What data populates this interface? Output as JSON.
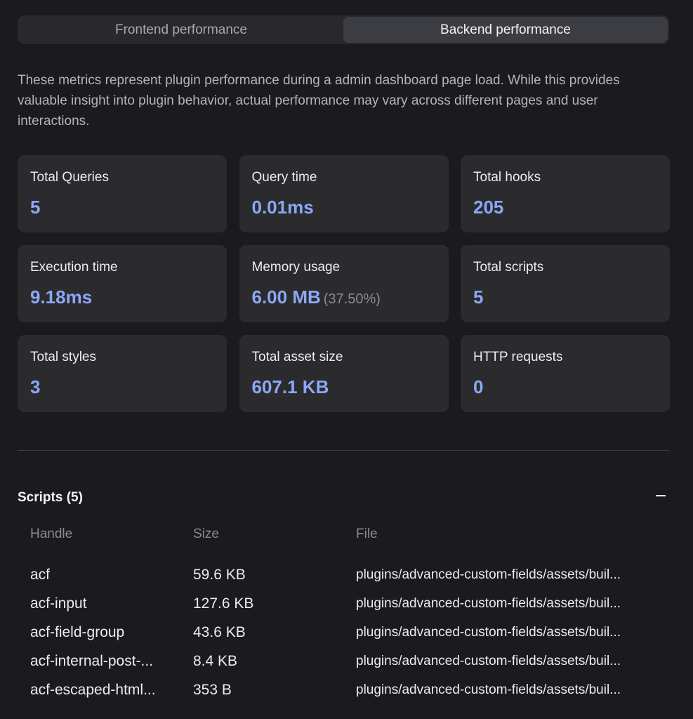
{
  "tabs": [
    {
      "label": "Frontend performance",
      "active": false
    },
    {
      "label": "Backend performance",
      "active": true
    }
  ],
  "description": "These metrics represent plugin performance during a admin dashboard page load. While this provides valuable insight into plugin behavior, actual performance may vary across different pages and user interactions.",
  "metrics": [
    {
      "label": "Total Queries",
      "value": "5",
      "sub": ""
    },
    {
      "label": "Query time",
      "value": "0.01ms",
      "sub": ""
    },
    {
      "label": "Total hooks",
      "value": "205",
      "sub": ""
    },
    {
      "label": "Execution time",
      "value": "9.18ms",
      "sub": ""
    },
    {
      "label": "Memory usage",
      "value": "6.00 MB",
      "sub": "(37.50%)"
    },
    {
      "label": "Total scripts",
      "value": "5",
      "sub": ""
    },
    {
      "label": "Total styles",
      "value": "3",
      "sub": ""
    },
    {
      "label": "Total asset size",
      "value": "607.1 KB",
      "sub": ""
    },
    {
      "label": "HTTP requests",
      "value": "0",
      "sub": ""
    }
  ],
  "scripts": {
    "title": "Scripts (5)",
    "collapse_icon": "minus-icon",
    "columns": {
      "handle": "Handle",
      "size": "Size",
      "file": "File"
    },
    "rows": [
      {
        "handle": "acf",
        "size": "59.6 KB",
        "file": "plugins/advanced-custom-fields/assets/buil..."
      },
      {
        "handle": "acf-input",
        "size": "127.6 KB",
        "file": "plugins/advanced-custom-fields/assets/buil..."
      },
      {
        "handle": "acf-field-group",
        "size": "43.6 KB",
        "file": "plugins/advanced-custom-fields/assets/buil..."
      },
      {
        "handle": "acf-internal-post-...",
        "size": "8.4 KB",
        "file": "plugins/advanced-custom-fields/assets/buil..."
      },
      {
        "handle": "acf-escaped-html...",
        "size": "353 B",
        "file": "plugins/advanced-custom-fields/assets/buil..."
      }
    ]
  },
  "colors": {
    "background": "#1b1b1d",
    "card": "#2b2b2e",
    "accent": "#8ba7f6",
    "muted": "#8a8a90"
  }
}
